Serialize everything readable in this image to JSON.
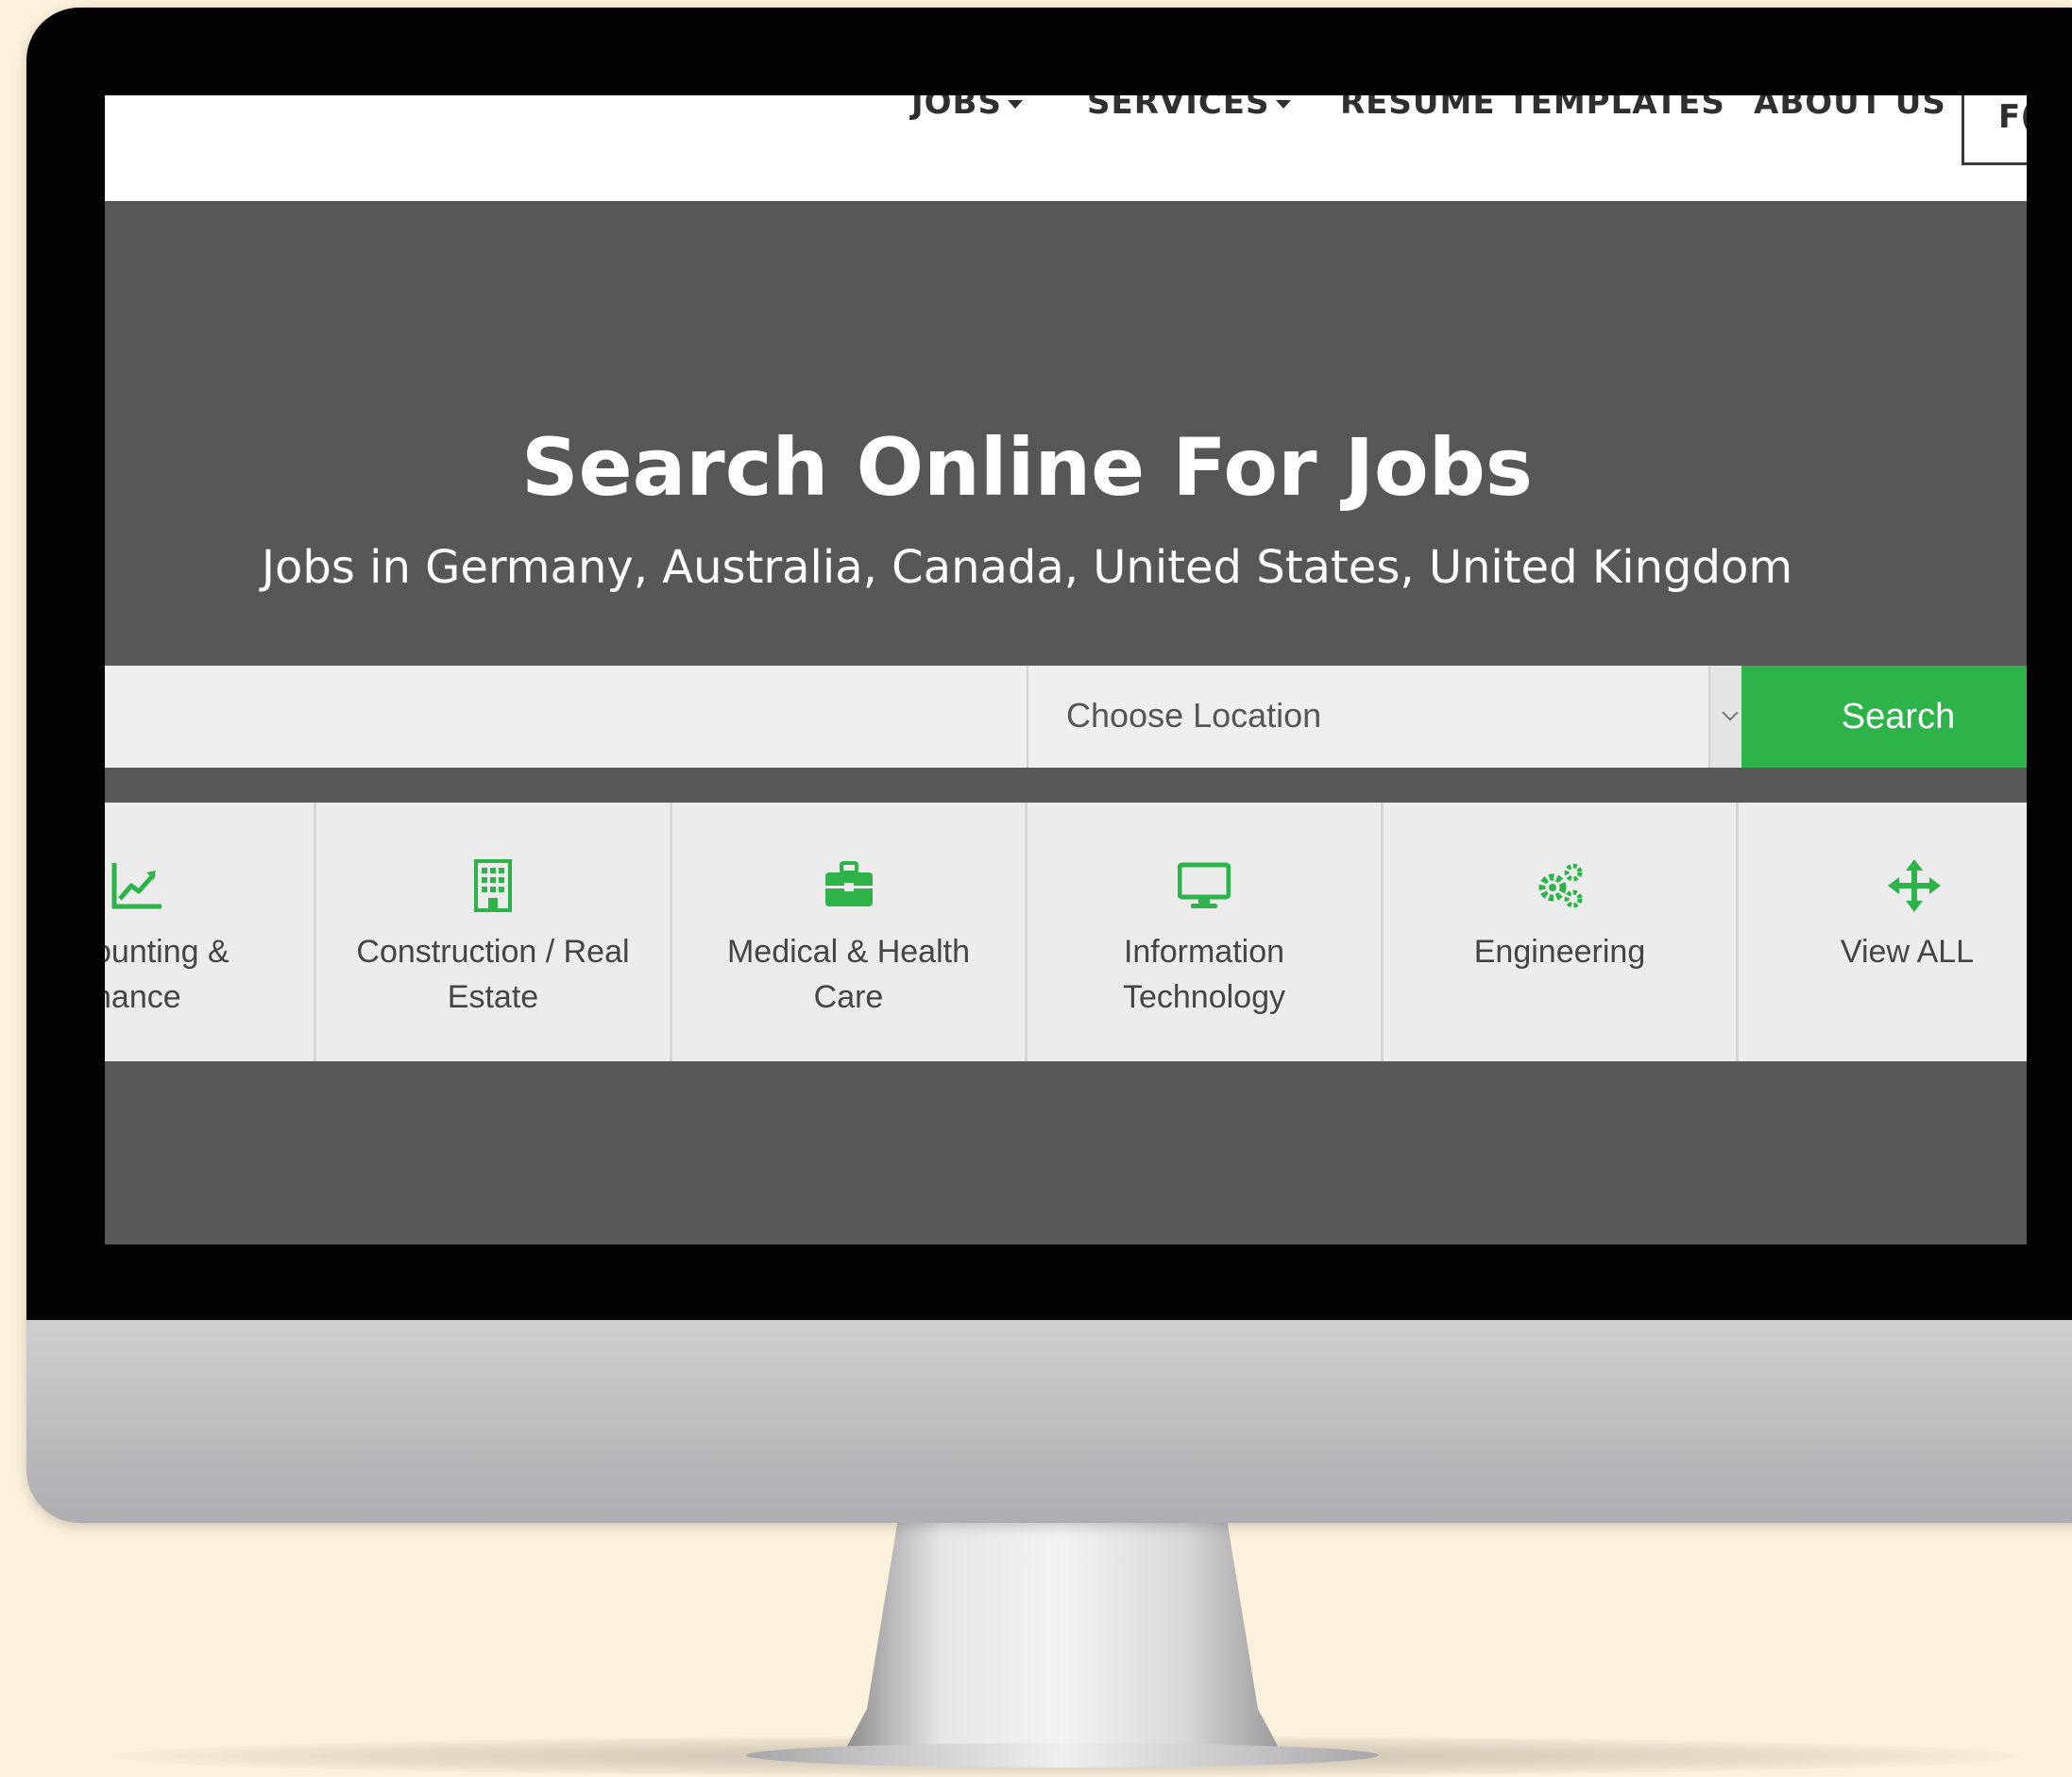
{
  "nav": {
    "items": [
      {
        "label": "JOBS",
        "has_dropdown": true
      },
      {
        "label": "SERVICES",
        "has_dropdown": true
      },
      {
        "label": "RESUME TEMPLATES",
        "has_dropdown": false
      },
      {
        "label": "ABOUT US",
        "has_dropdown": false
      }
    ],
    "cut_item": "F("
  },
  "hero": {
    "title": "Search Online For Jobs",
    "subtitle": "Jobs in Germany, Australia, Canada, United States, United Kingdom"
  },
  "search": {
    "keyword_value": "",
    "location_label": "Choose Location",
    "button_label": "Search"
  },
  "categories": [
    {
      "label": "ounting & nance",
      "icon": "line-chart-icon"
    },
    {
      "label": "Construction / Real Estate",
      "icon": "building-icon"
    },
    {
      "label": "Medical & Health Care",
      "icon": "briefcase-icon"
    },
    {
      "label": "Information Technology",
      "icon": "monitor-icon"
    },
    {
      "label": "Engineering",
      "icon": "gears-icon"
    },
    {
      "label": "View ALL",
      "icon": "move-arrows-icon"
    }
  ],
  "colors": {
    "accent_green": "#2eb34b",
    "hero_bg": "#575757",
    "page_bg": "#fcf1dc"
  }
}
